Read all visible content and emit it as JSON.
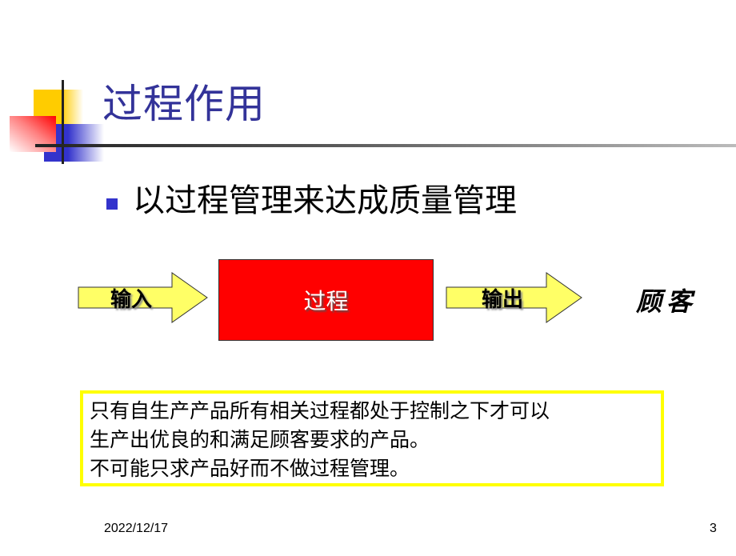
{
  "slide": {
    "title": "过程作用",
    "bullet": "以过程管理来达成质量管理",
    "diagram": {
      "input_label": "输入",
      "process_label": "过程",
      "output_label": "输出",
      "customer_label": "顾客",
      "colors": {
        "arrow_fill": "#ffff66",
        "process_fill": "#ff0000",
        "title": "#333399",
        "bullet": "#3333cc",
        "note_border": "#ffff00"
      }
    },
    "note": {
      "lines": [
        "只有自生产产品所有相关过程都处于控制之下才可以",
        "生产出优良的和满足顾客要求的产品。",
        "不可能只求产品好而不做过程管理。"
      ]
    },
    "footer": {
      "date": "2022/12/17",
      "page_number": "3"
    }
  }
}
